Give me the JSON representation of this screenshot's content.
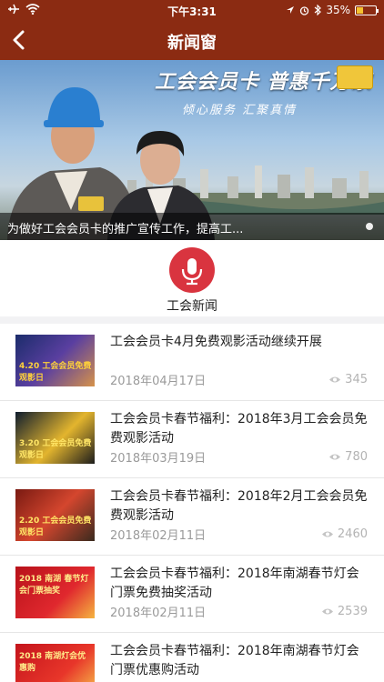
{
  "status_bar": {
    "time": "下午3:31",
    "battery": "35%",
    "battery_level": 0.35
  },
  "nav": {
    "title": "新闻窗",
    "back_icon": "chevron-left-icon"
  },
  "banner": {
    "slogan_main": "工会会员卡 普惠千万家",
    "slogan_sub": "倾心服务  汇聚真情",
    "caption": "为做好工会会员卡的推广宣传工作，提高工..."
  },
  "category": {
    "label": "工会新闻",
    "icon": "microphone-icon",
    "accent": "#d9343f"
  },
  "news": [
    {
      "title": "工会会员卡4月免费观影活动继续开展",
      "date": "2018年04月17日",
      "views": "345",
      "thumb_text": "4.20 工会会员免费观影日"
    },
    {
      "title": "工会会员卡春节福利：2018年3月工会会员免费观影活动",
      "date": "2018年03月19日",
      "views": "780",
      "thumb_text": "3.20 工会会员免费观影日"
    },
    {
      "title": "工会会员卡春节福利：2018年2月工会会员免费观影活动",
      "date": "2018年02月11日",
      "views": "2460",
      "thumb_text": "2.20 工会会员免费观影日"
    },
    {
      "title": "工会会员卡春节福利：2018年南湖春节灯会门票免费抽奖活动",
      "date": "2018年02月11日",
      "views": "2539",
      "thumb_text": "2018 南湖 春节灯会门票抽奖"
    },
    {
      "title": "工会会员卡春节福利：2018年南湖春节灯会门票优惠购活动",
      "date": "",
      "views": "",
      "thumb_text": "2018 南湖灯会优惠购"
    }
  ],
  "colors": {
    "brand": "#8b2b12",
    "accent": "#d9343f"
  }
}
